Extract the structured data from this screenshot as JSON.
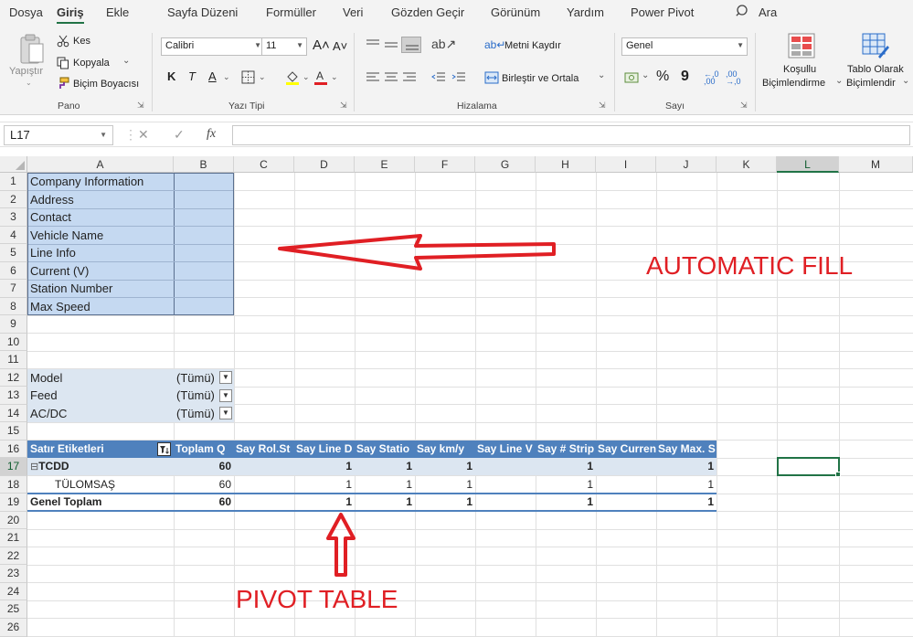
{
  "menubar": {
    "tabs": [
      "Dosya",
      "Giriş",
      "Ekle",
      "Sayfa Düzeni",
      "Formüller",
      "Veri",
      "Gözden Geçir",
      "Görünüm",
      "Yardım",
      "Power Pivot"
    ],
    "active_tab": "Giriş",
    "search_label": "Ara"
  },
  "ribbon": {
    "clipboard": {
      "paste": "Yapıştır",
      "cut": "Kes",
      "copy": "Kopyala",
      "format_painter": "Biçim Boyacısı",
      "group": "Pano"
    },
    "font": {
      "font_name": "Calibri",
      "font_size": "11",
      "bold": "K",
      "italic": "T",
      "underline": "A",
      "group": "Yazı Tipi"
    },
    "alignment": {
      "wrap_text": "Metni Kaydır",
      "merge_center": "Birleştir ve Ortala",
      "group": "Hizalama"
    },
    "number": {
      "format": "Genel",
      "percent": "%",
      "comma": "9",
      "increase_decimal": "←,0 ,00",
      "decrease_decimal": ",00 →,0",
      "group": "Sayı"
    },
    "styles": {
      "conditional_1": "Koşullu",
      "conditional_2": "Biçimlendirme",
      "table_1": "Tablo Olarak",
      "table_2": "Biçimlendir"
    }
  },
  "formula_bar": {
    "name_box": "L17",
    "fx": "fx",
    "formula": ""
  },
  "columns": [
    "A",
    "B",
    "C",
    "D",
    "E",
    "F",
    "G",
    "H",
    "I",
    "J",
    "K",
    "L",
    "M"
  ],
  "selected_column": "L",
  "rows": [
    "1",
    "2",
    "3",
    "4",
    "5",
    "6",
    "7",
    "8",
    "9",
    "10",
    "11",
    "12",
    "13",
    "14",
    "15",
    "16",
    "17",
    "18",
    "19",
    "20",
    "21",
    "22",
    "23",
    "24",
    "25",
    "26"
  ],
  "selected_row": "17",
  "info_block": [
    "Company Information",
    "Address",
    "Contact",
    "Vehicle Name",
    "Line Info",
    "Current (V)",
    "Station Number",
    "Max Speed"
  ],
  "filters": [
    {
      "label": "Model",
      "value": "(Tümü)"
    },
    {
      "label": "Feed",
      "value": "(Tümü)"
    },
    {
      "label": "AC/DC",
      "value": "(Tümü)"
    }
  ],
  "pivot": {
    "headers": [
      "Satır Etiketleri",
      "Toplam Q",
      "Say Rol.St",
      "Say Line D",
      "Say Statio",
      "Say km/y",
      "Say Line V",
      "Say # Strip",
      "Say Curren",
      "Say Max. S"
    ],
    "rows": [
      {
        "label": "TCDD",
        "collapse": "⊟",
        "values": [
          "60",
          "",
          "1",
          "1",
          "1",
          "",
          "1",
          "",
          "1"
        ]
      },
      {
        "label": "TÜLOMSAŞ",
        "values": [
          "60",
          "",
          "1",
          "1",
          "1",
          "",
          "1",
          "",
          "1"
        ]
      },
      {
        "label": "Genel Toplam",
        "values": [
          "60",
          "",
          "1",
          "1",
          "1",
          "",
          "1",
          "",
          "1"
        ]
      }
    ]
  },
  "annotations": {
    "automatic_fill": "AUTOMATIC FILL",
    "pivot_table": "PIVOT TABLE"
  },
  "colors": {
    "accent": "#217346",
    "annotation": "#e01f24",
    "pivot_header": "#4f81bd",
    "info_fill": "#c5d9f1"
  }
}
